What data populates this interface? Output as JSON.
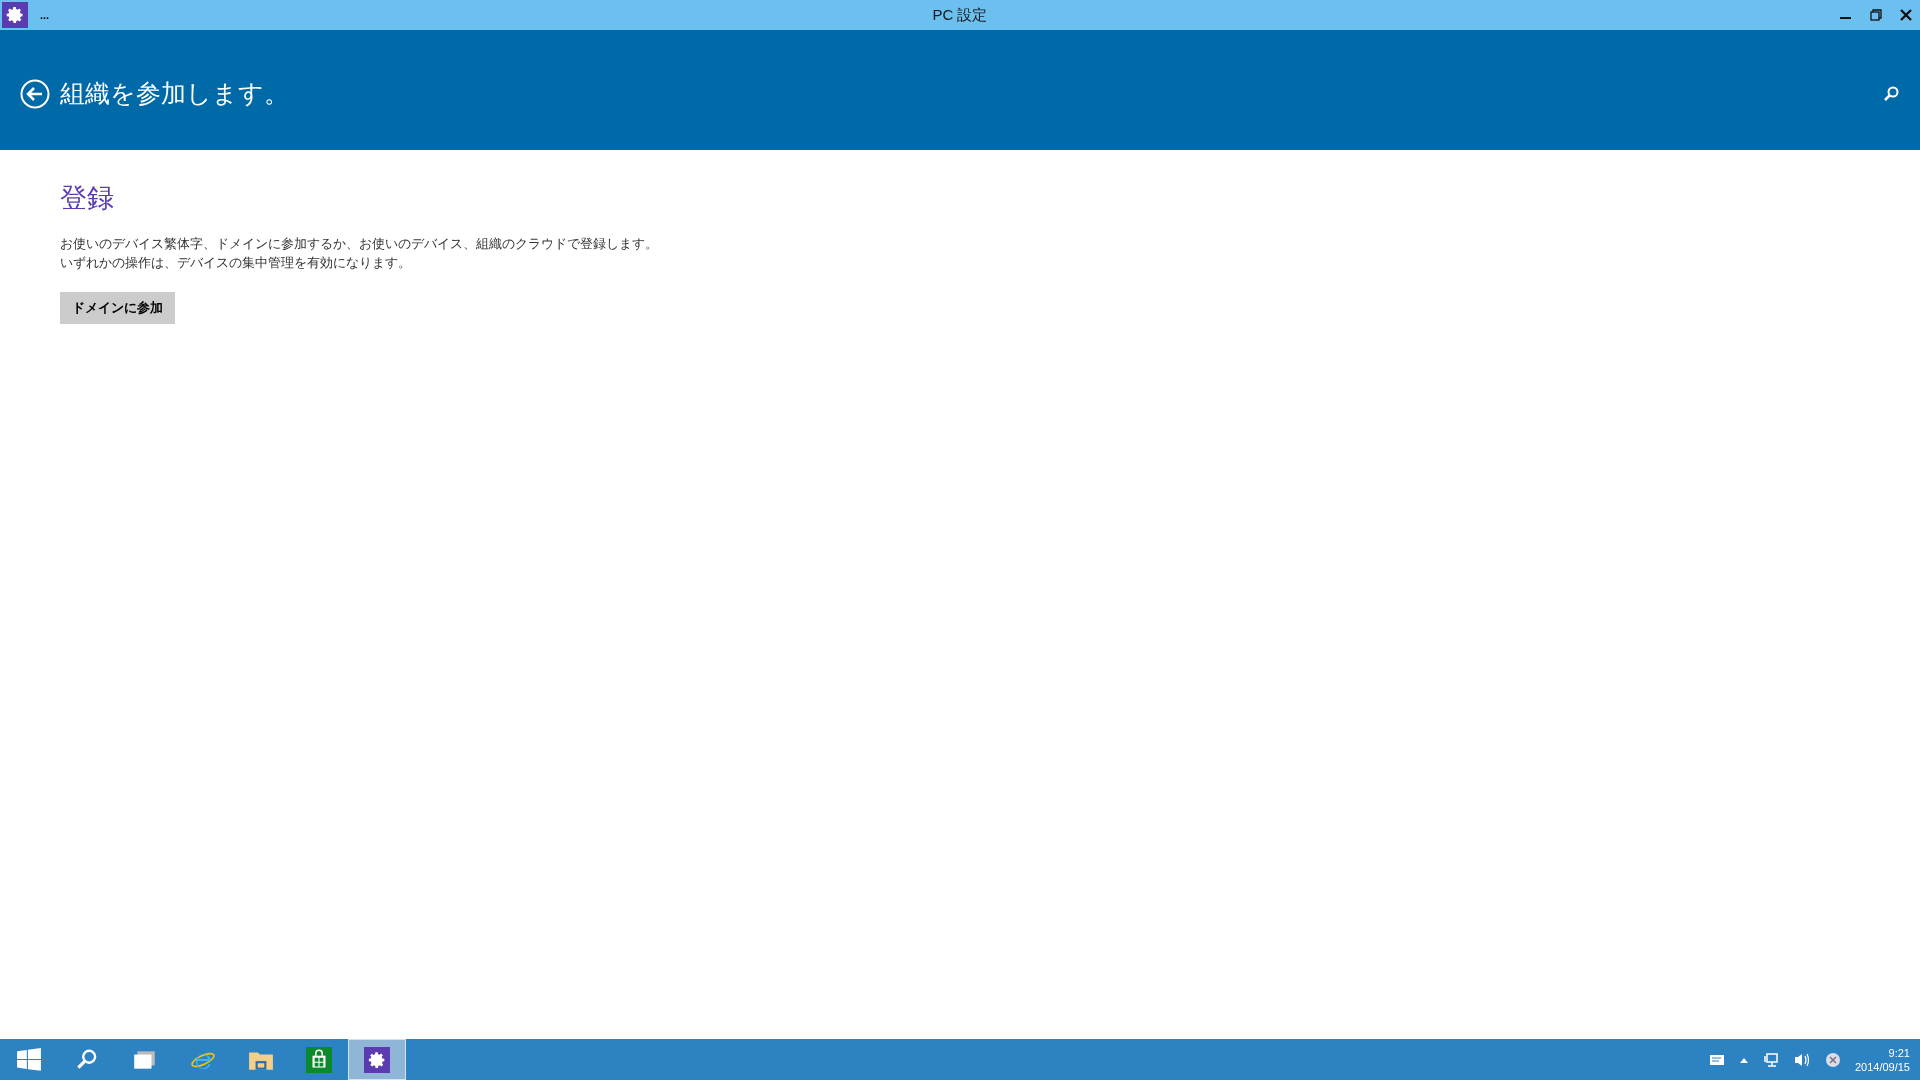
{
  "window": {
    "title": "PC 設定",
    "menu": "..."
  },
  "header": {
    "title": "組織を参加します。"
  },
  "section": {
    "heading": "登録",
    "description": "お使いのデバイス繁体字、ドメインに参加するか、お使いのデバイス、組織のクラウドで登録します。いずれかの操作は、デバイスの集中管理を有効になります。",
    "button": "ドメインに参加"
  },
  "taskbar": {
    "items": [
      {
        "kind": "start",
        "selected": false
      },
      {
        "kind": "search",
        "selected": false
      },
      {
        "kind": "taskview",
        "selected": false
      },
      {
        "kind": "browser",
        "selected": false
      },
      {
        "kind": "folder",
        "selected": false
      },
      {
        "kind": "store",
        "selected": false
      },
      {
        "kind": "settings",
        "selected": true
      }
    ],
    "clock": {
      "time": "9:21",
      "date": "2014/09/15"
    }
  }
}
